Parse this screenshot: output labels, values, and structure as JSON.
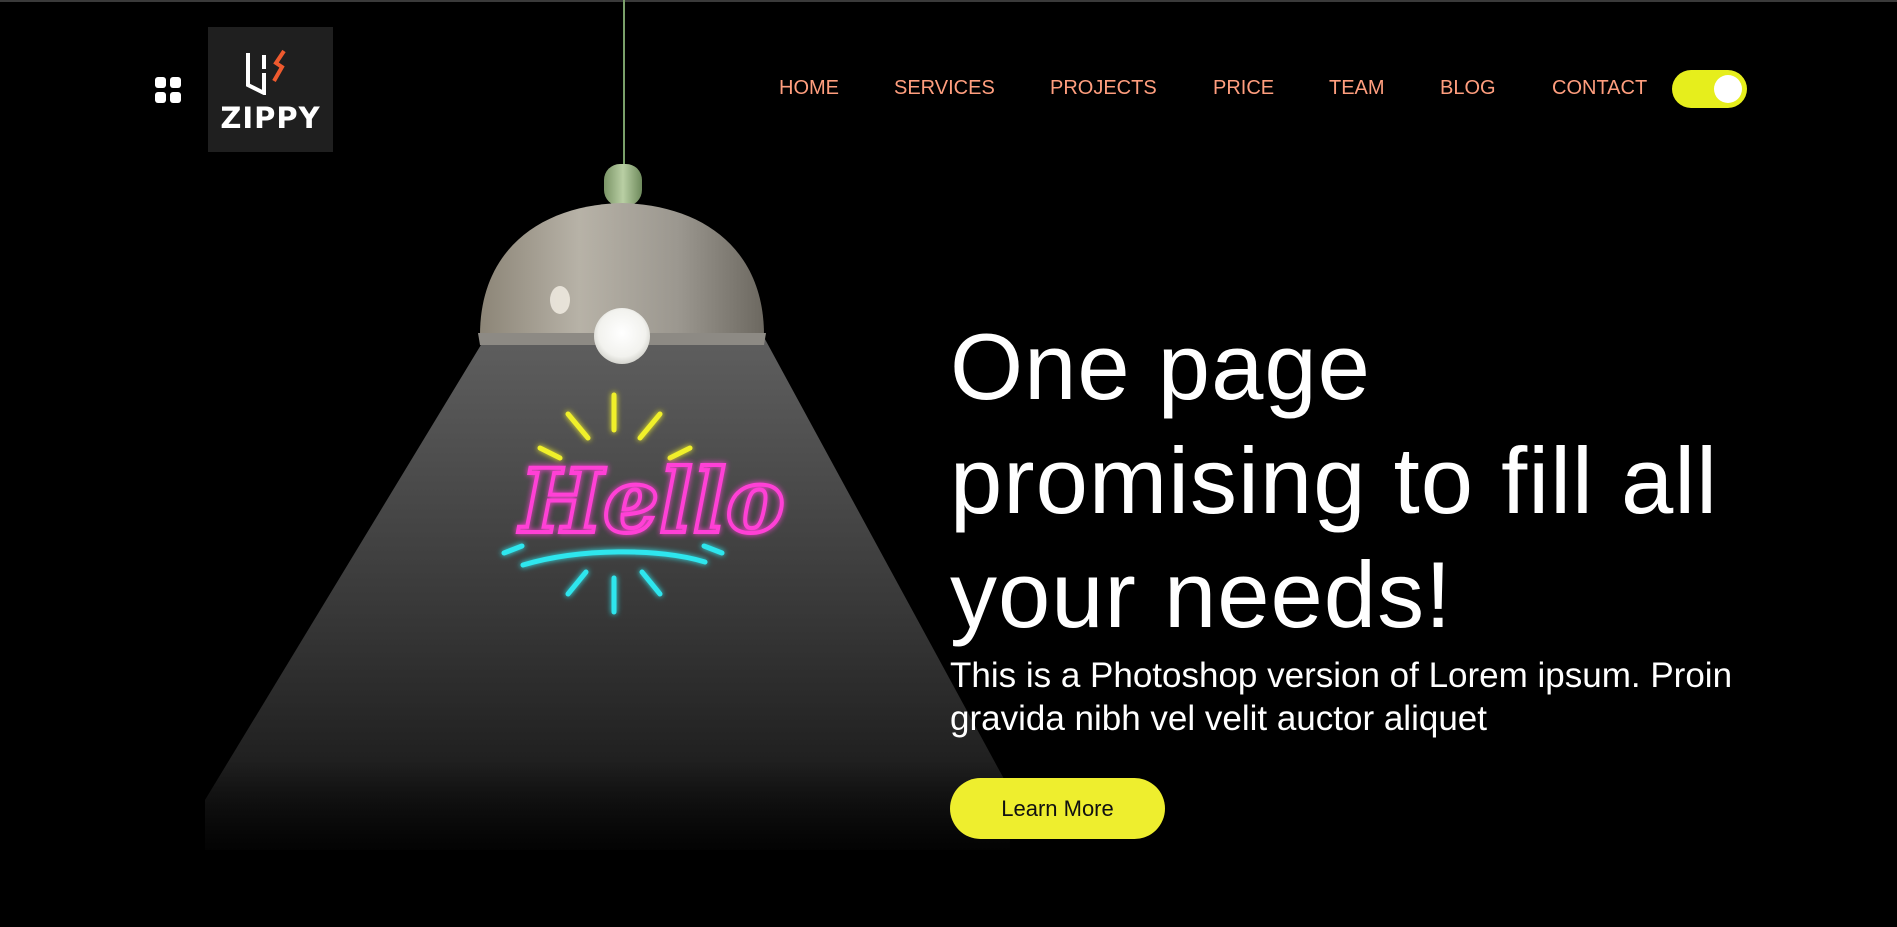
{
  "header": {
    "logo_text": "ZIPPY",
    "menu_icon": "grid-icon",
    "nav": [
      {
        "label": "HOME"
      },
      {
        "label": "SERVICES"
      },
      {
        "label": "PROJECTS"
      },
      {
        "label": "PRICE"
      },
      {
        "label": "TEAM"
      },
      {
        "label": "BLOG"
      },
      {
        "label": "CONTACT"
      }
    ],
    "theme_toggle": {
      "state": "on",
      "color": "#e6ee1c"
    }
  },
  "hero": {
    "title": "One page promising to fill all your needs!",
    "subtitle": "This is a Photoshop version of Lorem ipsum. Proin gravida nibh vel velit auctor aliquet",
    "cta_label": "Learn More",
    "neon_sign_text": "Hello"
  },
  "colors": {
    "background": "#000000",
    "nav_text": "#ff9e7e",
    "accent_yellow": "#eeee2e",
    "neon_pink": "#ff3fd6",
    "neon_cyan": "#2ee6ee",
    "neon_yellow": "#f0f02a"
  }
}
